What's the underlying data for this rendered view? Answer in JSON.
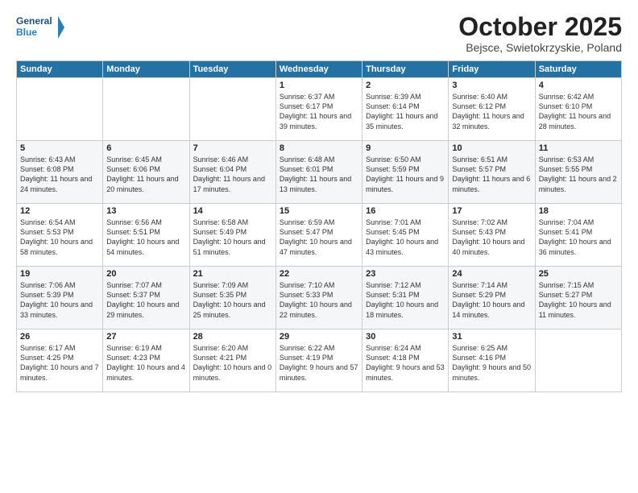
{
  "header": {
    "logo_line1": "General",
    "logo_line2": "Blue",
    "month": "October 2025",
    "location": "Bejsce, Swietokrzyskie, Poland"
  },
  "weekdays": [
    "Sunday",
    "Monday",
    "Tuesday",
    "Wednesday",
    "Thursday",
    "Friday",
    "Saturday"
  ],
  "weeks": [
    [
      {
        "day": "",
        "text": ""
      },
      {
        "day": "",
        "text": ""
      },
      {
        "day": "",
        "text": ""
      },
      {
        "day": "1",
        "text": "Sunrise: 6:37 AM\nSunset: 6:17 PM\nDaylight: 11 hours\nand 39 minutes."
      },
      {
        "day": "2",
        "text": "Sunrise: 6:39 AM\nSunset: 6:14 PM\nDaylight: 11 hours\nand 35 minutes."
      },
      {
        "day": "3",
        "text": "Sunrise: 6:40 AM\nSunset: 6:12 PM\nDaylight: 11 hours\nand 32 minutes."
      },
      {
        "day": "4",
        "text": "Sunrise: 6:42 AM\nSunset: 6:10 PM\nDaylight: 11 hours\nand 28 minutes."
      }
    ],
    [
      {
        "day": "5",
        "text": "Sunrise: 6:43 AM\nSunset: 6:08 PM\nDaylight: 11 hours\nand 24 minutes."
      },
      {
        "day": "6",
        "text": "Sunrise: 6:45 AM\nSunset: 6:06 PM\nDaylight: 11 hours\nand 20 minutes."
      },
      {
        "day": "7",
        "text": "Sunrise: 6:46 AM\nSunset: 6:04 PM\nDaylight: 11 hours\nand 17 minutes."
      },
      {
        "day": "8",
        "text": "Sunrise: 6:48 AM\nSunset: 6:01 PM\nDaylight: 11 hours\nand 13 minutes."
      },
      {
        "day": "9",
        "text": "Sunrise: 6:50 AM\nSunset: 5:59 PM\nDaylight: 11 hours\nand 9 minutes."
      },
      {
        "day": "10",
        "text": "Sunrise: 6:51 AM\nSunset: 5:57 PM\nDaylight: 11 hours\nand 6 minutes."
      },
      {
        "day": "11",
        "text": "Sunrise: 6:53 AM\nSunset: 5:55 PM\nDaylight: 11 hours\nand 2 minutes."
      }
    ],
    [
      {
        "day": "12",
        "text": "Sunrise: 6:54 AM\nSunset: 5:53 PM\nDaylight: 10 hours\nand 58 minutes."
      },
      {
        "day": "13",
        "text": "Sunrise: 6:56 AM\nSunset: 5:51 PM\nDaylight: 10 hours\nand 54 minutes."
      },
      {
        "day": "14",
        "text": "Sunrise: 6:58 AM\nSunset: 5:49 PM\nDaylight: 10 hours\nand 51 minutes."
      },
      {
        "day": "15",
        "text": "Sunrise: 6:59 AM\nSunset: 5:47 PM\nDaylight: 10 hours\nand 47 minutes."
      },
      {
        "day": "16",
        "text": "Sunrise: 7:01 AM\nSunset: 5:45 PM\nDaylight: 10 hours\nand 43 minutes."
      },
      {
        "day": "17",
        "text": "Sunrise: 7:02 AM\nSunset: 5:43 PM\nDaylight: 10 hours\nand 40 minutes."
      },
      {
        "day": "18",
        "text": "Sunrise: 7:04 AM\nSunset: 5:41 PM\nDaylight: 10 hours\nand 36 minutes."
      }
    ],
    [
      {
        "day": "19",
        "text": "Sunrise: 7:06 AM\nSunset: 5:39 PM\nDaylight: 10 hours\nand 33 minutes."
      },
      {
        "day": "20",
        "text": "Sunrise: 7:07 AM\nSunset: 5:37 PM\nDaylight: 10 hours\nand 29 minutes."
      },
      {
        "day": "21",
        "text": "Sunrise: 7:09 AM\nSunset: 5:35 PM\nDaylight: 10 hours\nand 25 minutes."
      },
      {
        "day": "22",
        "text": "Sunrise: 7:10 AM\nSunset: 5:33 PM\nDaylight: 10 hours\nand 22 minutes."
      },
      {
        "day": "23",
        "text": "Sunrise: 7:12 AM\nSunset: 5:31 PM\nDaylight: 10 hours\nand 18 minutes."
      },
      {
        "day": "24",
        "text": "Sunrise: 7:14 AM\nSunset: 5:29 PM\nDaylight: 10 hours\nand 14 minutes."
      },
      {
        "day": "25",
        "text": "Sunrise: 7:15 AM\nSunset: 5:27 PM\nDaylight: 10 hours\nand 11 minutes."
      }
    ],
    [
      {
        "day": "26",
        "text": "Sunrise: 6:17 AM\nSunset: 4:25 PM\nDaylight: 10 hours\nand 7 minutes."
      },
      {
        "day": "27",
        "text": "Sunrise: 6:19 AM\nSunset: 4:23 PM\nDaylight: 10 hours\nand 4 minutes."
      },
      {
        "day": "28",
        "text": "Sunrise: 6:20 AM\nSunset: 4:21 PM\nDaylight: 10 hours\nand 0 minutes."
      },
      {
        "day": "29",
        "text": "Sunrise: 6:22 AM\nSunset: 4:19 PM\nDaylight: 9 hours\nand 57 minutes."
      },
      {
        "day": "30",
        "text": "Sunrise: 6:24 AM\nSunset: 4:18 PM\nDaylight: 9 hours\nand 53 minutes."
      },
      {
        "day": "31",
        "text": "Sunrise: 6:25 AM\nSunset: 4:16 PM\nDaylight: 9 hours\nand 50 minutes."
      },
      {
        "day": "",
        "text": ""
      }
    ]
  ]
}
